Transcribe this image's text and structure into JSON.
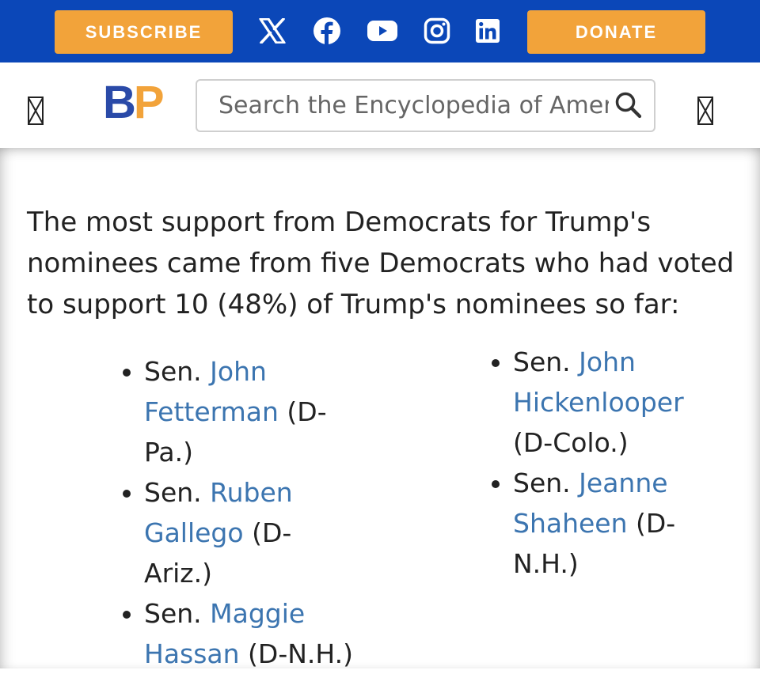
{
  "topbar": {
    "subscribe_label": "SUBSCRIBE",
    "donate_label": "DONATE",
    "background": "#0b47b8",
    "button_color": "#f2a33a",
    "social_icons": [
      "x-icon",
      "facebook-icon",
      "youtube-icon",
      "instagram-icon",
      "linkedin-icon"
    ]
  },
  "header": {
    "logo_b": "B",
    "logo_p": "P",
    "search_placeholder": "Search the Encyclopedia of American Politics"
  },
  "content": {
    "intro": "The most support from Democrats for Trump's nominees came from five Democrats who had voted to support 10 (48%) of Trump's nominees so far:",
    "left_list": [
      {
        "prefix": "Sen. ",
        "name": "John Fetterman",
        "party": " (D-Pa.)"
      },
      {
        "prefix": "Sen. ",
        "name": "Ruben Gallego",
        "party": " (D-Ariz.)"
      },
      {
        "prefix": "Sen. ",
        "name": "Maggie Hassan",
        "party": " (D-N.H.)"
      }
    ],
    "right_list": [
      {
        "prefix": "Sen. ",
        "name": "John Hickenlooper",
        "party": " (D-Colo.)"
      },
      {
        "prefix": "Sen. ",
        "name": "Jeanne Shaheen",
        "party": " (D-N.H.)"
      }
    ],
    "link_color": "#3c75b0"
  }
}
